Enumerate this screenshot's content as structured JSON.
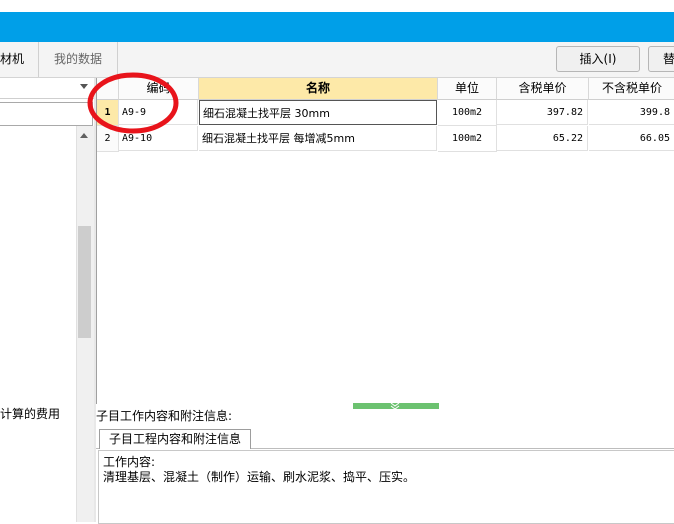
{
  "tabs": [
    {
      "label": "材机"
    },
    {
      "label": "我的数据"
    }
  ],
  "toolbar": {
    "insert_label": "插入(I)",
    "second_label": "替"
  },
  "left_panel": {
    "tree_item": "计算的费用"
  },
  "grid": {
    "columns": [
      "",
      "编码",
      "名称",
      "单位",
      "含税单价",
      "不含税单价"
    ],
    "rows": [
      {
        "num": "1",
        "code": "A9-9",
        "name": "细石混凝土找平层 30mm",
        "unit": "100m2",
        "price_tax": "397.82",
        "price_notax": "399.8"
      },
      {
        "num": "2",
        "code": "A9-10",
        "name": "细石混凝土找平层 每增减5mm",
        "unit": "100m2",
        "price_tax": "65.22",
        "price_notax": "66.05"
      }
    ]
  },
  "notes": {
    "title": "子目工作内容和附注信息:",
    "tab_label": "子目工程内容和附注信息",
    "line1": "工作内容:",
    "line2": "清理基层、混凝土（制作）运输、刷水泥浆、捣平、压实。"
  },
  "colors": {
    "title_bar": "#009fe8",
    "selected_header": "#fde9a8",
    "annotation_circle": "#e8141b",
    "splitter": "#6cc270"
  },
  "icons": [
    "scroll-up-icon",
    "dropdown-arrow-icon",
    "splitter-expand-icon"
  ]
}
